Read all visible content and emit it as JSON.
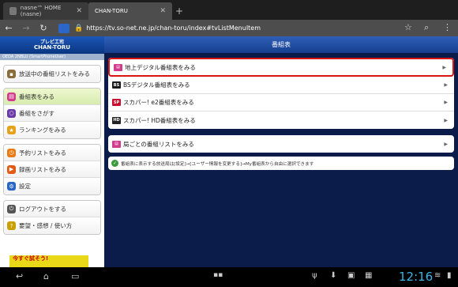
{
  "browser": {
    "tabs": [
      {
        "label": "nasne™ HOME (nasne)"
      },
      {
        "label": "CHAN-TORU"
      }
    ],
    "url": "https://tv.so-net.ne.jp/chan-toru/index#tvListMenuItem"
  },
  "sidebar": {
    "logo_line1": "プレビ工司",
    "logo_line2": "CHAN-TORU",
    "user_id": "OEDA 2NBLU (SmartPhoneUser)",
    "groups": [
      [
        {
          "label": "放送中の番組リストをみる",
          "icon_color": "#8a6d3b"
        }
      ],
      [
        {
          "label": "番組表をみる",
          "icon_color": "#d23c8c",
          "active": true
        },
        {
          "label": "番組をさがす",
          "icon_color": "#6b3aa8"
        },
        {
          "label": "ランキングをみる",
          "icon_color": "#e6a21a"
        }
      ],
      [
        {
          "label": "予約リストをみる",
          "icon_color": "#e87a15"
        },
        {
          "label": "録画リストをみる",
          "icon_color": "#e35a15"
        },
        {
          "label": "設定",
          "icon_color": "#2a66c6"
        }
      ],
      [
        {
          "label": "ログアウトをする",
          "icon_color": "#555555"
        },
        {
          "label": "要望・感想 / 使い方",
          "icon_color": "#c8a000"
        }
      ]
    ],
    "banner": "今すぐ試そう!"
  },
  "main": {
    "title": "番組表",
    "items": [
      {
        "label": "地上デジタル番組表をみる",
        "icon": "",
        "icon_color": "#d23c8c",
        "selected": true
      },
      {
        "label": "BSデジタル番組表をみる",
        "icon": "BS",
        "icon_color": "#1a1a1a"
      },
      {
        "label": "スカパー! e2番組表をみる",
        "icon": "SP",
        "icon_color": "#c8102e"
      },
      {
        "label": "スカパー! HD番組表をみる",
        "icon": "HD",
        "icon_color": "#222222"
      }
    ],
    "channel_list": "局ごとの番組リストをみる",
    "note": "番組表に表示する放送局は[設定]→[ユーザー情報を変更する]→My番組表から自由に選択できます"
  },
  "system": {
    "clock": "12:16"
  }
}
